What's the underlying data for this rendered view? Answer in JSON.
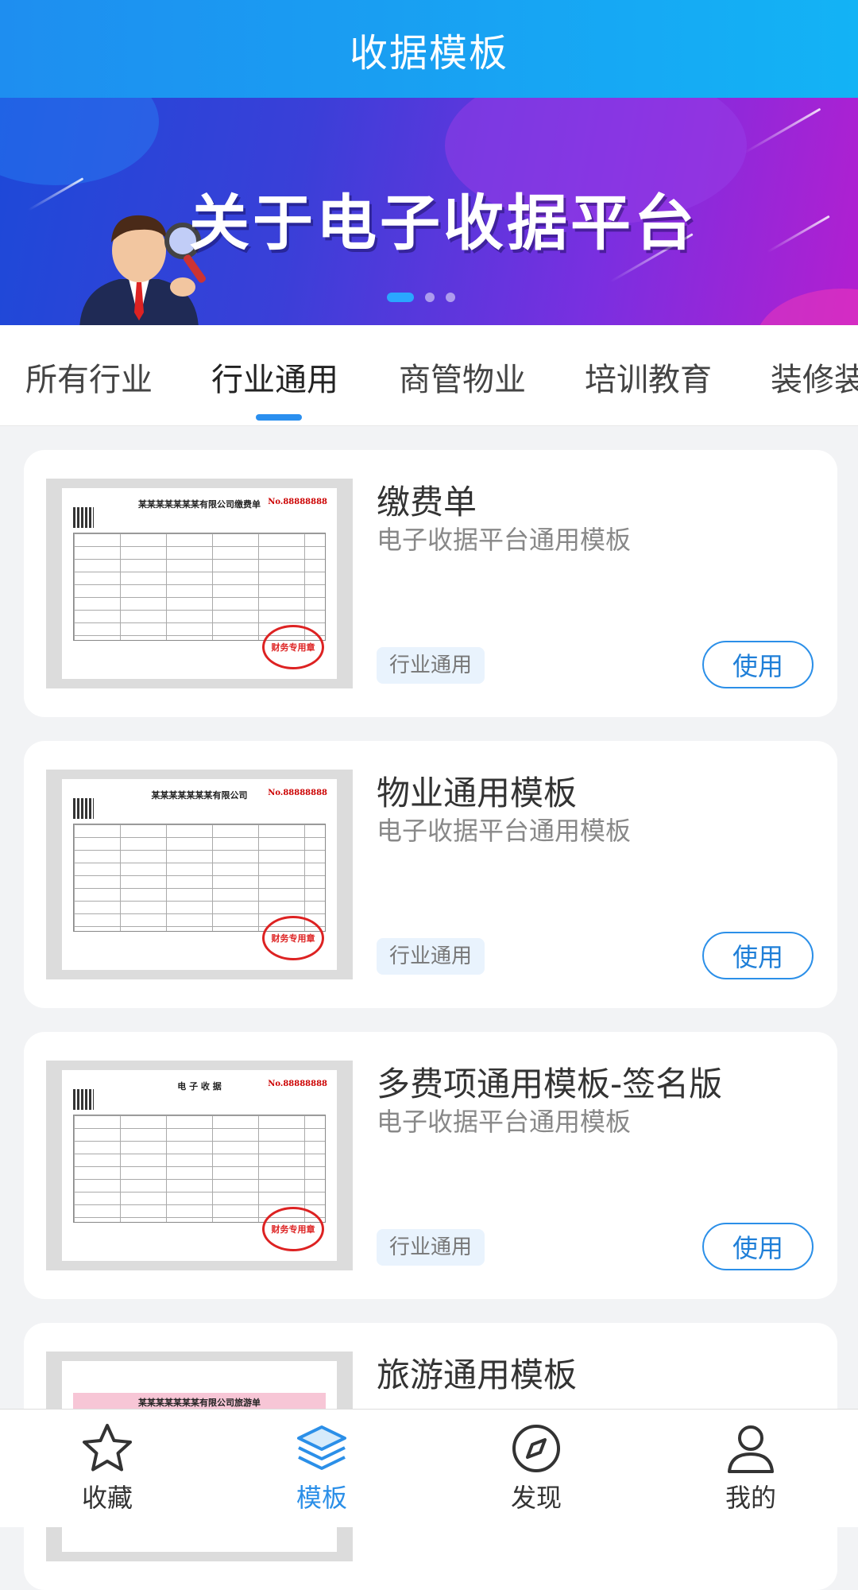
{
  "header": {
    "title": "收据模板"
  },
  "banner": {
    "title": "关于电子收据平台",
    "slide_count": 3,
    "active_slide": 1
  },
  "categories": {
    "items": [
      "所有行业",
      "行业通用",
      "商管物业",
      "培训教育",
      "装修装"
    ],
    "active_index": 1
  },
  "templates": [
    {
      "title": "缴费单",
      "subtitle": "电子收据平台通用模板",
      "tag": "行业通用",
      "action": "使用"
    },
    {
      "title": "物业通用模板",
      "subtitle": "电子收据平台通用模板",
      "tag": "行业通用",
      "action": "使用"
    },
    {
      "title": "多费项通用模板-签名版",
      "subtitle": "电子收据平台通用模板",
      "tag": "行业通用",
      "action": "使用"
    },
    {
      "title": "旅游通用模板"
    }
  ],
  "thumbs": [
    {
      "doc_title": "某某某某某某某有限公司缴费单",
      "doc_no": "No.88888888",
      "stamp": "财务专用章"
    },
    {
      "doc_title": "某某某某某某某有限公司",
      "doc_no": "No.88888888",
      "stamp": "财务专用章"
    },
    {
      "doc_title": "电 子 收 据",
      "doc_no": "No.88888888",
      "stamp": "财务专用章"
    },
    {
      "doc_title": "某某某某某某某有限公司旅游单"
    }
  ],
  "tabbar": {
    "items": [
      {
        "label": "收藏",
        "icon": "star-icon"
      },
      {
        "label": "模板",
        "icon": "layers-icon"
      },
      {
        "label": "发现",
        "icon": "compass-icon"
      },
      {
        "label": "我的",
        "icon": "user-icon"
      }
    ],
    "active_index": 1
  },
  "colors": {
    "primary": "#2b8fe8",
    "header_start": "#1e8ef0",
    "header_end": "#13b3f5",
    "background": "#f2f3f5"
  }
}
